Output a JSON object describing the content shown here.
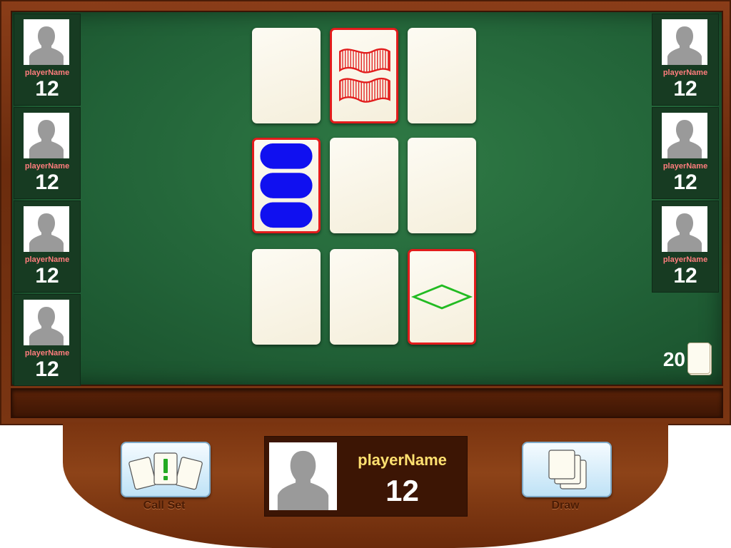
{
  "players_left": [
    {
      "name": "playerName",
      "score": "12"
    },
    {
      "name": "playerName",
      "score": "12"
    },
    {
      "name": "playerName",
      "score": "12"
    },
    {
      "name": "playerName",
      "score": "12"
    }
  ],
  "players_right": [
    {
      "name": "playerName",
      "score": "12"
    },
    {
      "name": "playerName",
      "score": "12"
    },
    {
      "name": "playerName",
      "score": "12"
    }
  ],
  "board": {
    "cards": [
      {
        "selected": false,
        "count": 0
      },
      {
        "selected": true,
        "count": 2,
        "shape": "squiggle",
        "color": "#e21c1c",
        "fill": "striped"
      },
      {
        "selected": false,
        "count": 0
      },
      {
        "selected": true,
        "count": 3,
        "shape": "oval",
        "color": "#1010f0",
        "fill": "solid"
      },
      {
        "selected": false,
        "count": 0
      },
      {
        "selected": false,
        "count": 0
      },
      {
        "selected": false,
        "count": 0
      },
      {
        "selected": false,
        "count": 0
      },
      {
        "selected": true,
        "count": 1,
        "shape": "diamond",
        "color": "#22bb22",
        "fill": "empty"
      }
    ]
  },
  "deck": {
    "remaining": "20"
  },
  "buttons": {
    "call_set": "Call Set",
    "draw": "Draw"
  },
  "me": {
    "name": "playerName",
    "score": "12"
  },
  "colors": {
    "selection_border": "#e21c1c",
    "felt": "#226338",
    "wood": "#7a3512"
  }
}
